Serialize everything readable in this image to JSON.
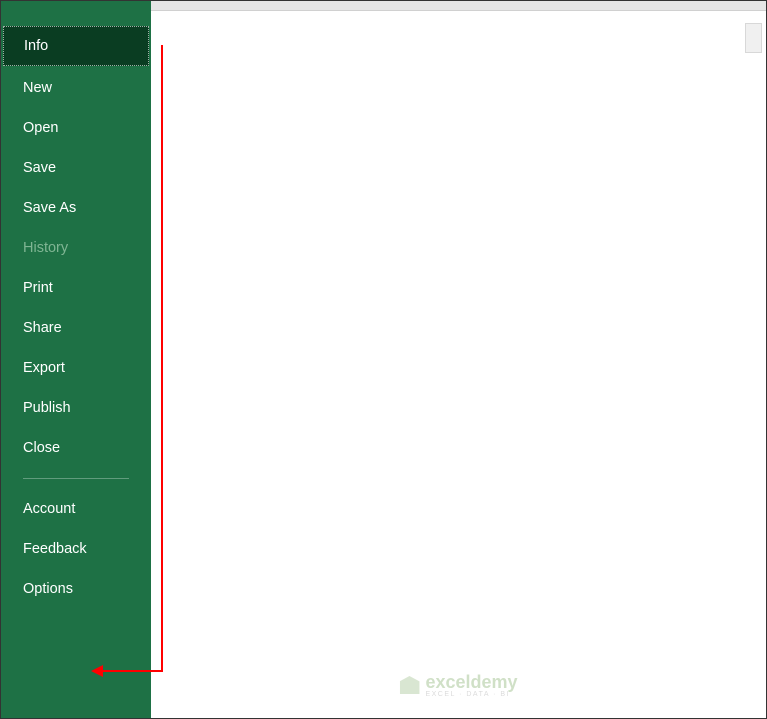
{
  "sidebar": {
    "items": [
      {
        "label": "Info",
        "state": "active"
      },
      {
        "label": "New",
        "state": "normal"
      },
      {
        "label": "Open",
        "state": "normal"
      },
      {
        "label": "Save",
        "state": "normal"
      },
      {
        "label": "Save As",
        "state": "normal"
      },
      {
        "label": "History",
        "state": "disabled"
      },
      {
        "label": "Print",
        "state": "normal"
      },
      {
        "label": "Share",
        "state": "normal"
      },
      {
        "label": "Export",
        "state": "normal"
      },
      {
        "label": "Publish",
        "state": "normal"
      },
      {
        "label": "Close",
        "state": "normal"
      },
      {
        "label": "Account",
        "state": "normal"
      },
      {
        "label": "Feedback",
        "state": "normal"
      },
      {
        "label": "Options",
        "state": "normal"
      }
    ]
  },
  "watermark": {
    "brand": "exceldemy",
    "tagline": "EXCEL · DATA · BI"
  }
}
